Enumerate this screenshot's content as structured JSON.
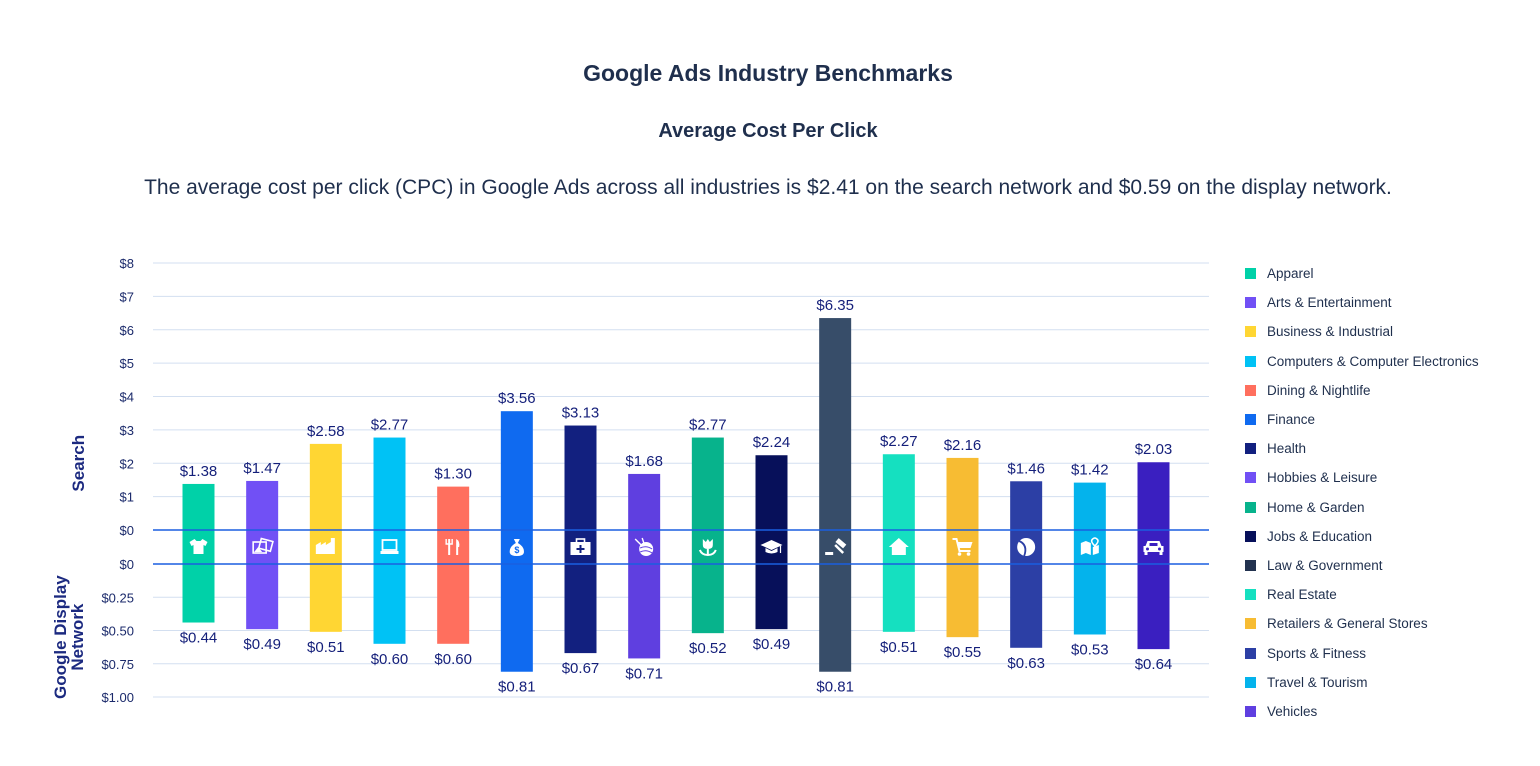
{
  "header": {
    "title": "Google Ads Industry Benchmarks",
    "subtitle": "Average Cost Per Click",
    "description": "The average cost per click (CPC) in Google Ads across all industries is $2.41 on the search network and $0.59 on the display network."
  },
  "chart_data": {
    "type": "bar",
    "title": "Google Ads Industry Benchmarks",
    "subtitle": "Average Cost Per Click",
    "ylabel_top": "Search",
    "ylabel_bottom": "Google Display Network",
    "search_axis": {
      "ylim": [
        0,
        8
      ],
      "ticks": [
        "$0",
        "$1",
        "$2",
        "$3",
        "$4",
        "$5",
        "$6",
        "$7",
        "$8"
      ],
      "tick_values": [
        0,
        1,
        2,
        3,
        4,
        5,
        6,
        7,
        8
      ]
    },
    "display_axis": {
      "ylim": [
        0,
        1
      ],
      "ticks": [
        "$0",
        "$0.25",
        "$0.50",
        "$0.75",
        "$1.00"
      ],
      "tick_values": [
        0,
        0.25,
        0.5,
        0.75,
        1
      ]
    },
    "grid": true,
    "legend_position": "right",
    "categories": [
      "Apparel",
      "Arts & Entertainment",
      "Business & Industrial",
      "Computers & Computer Electronics",
      "Dining & Nightlife",
      "Finance",
      "Health",
      "Hobbies & Leisure",
      "Home & Garden",
      "Jobs & Education",
      "Law & Government",
      "Real Estate",
      "Retailers & General Stores",
      "Sports & Fitness",
      "Travel & Tourism",
      "Vehicles"
    ],
    "colors": [
      "#00d1a8",
      "#7150f5",
      "#ffd633",
      "#00c2f5",
      "#ff6f5e",
      "#0f6af0",
      "#12207f",
      "#5f3fe0",
      "#07b38c",
      "#07105a",
      "#374d69",
      "#15e0c0",
      "#f7bc33",
      "#2c3fa5",
      "#04b3ec",
      "#3a1fc0"
    ],
    "icons": [
      "tshirt-icon",
      "pictures-icon",
      "factory-icon",
      "laptop-icon",
      "fork-knife-icon",
      "money-bag-icon",
      "first-aid-kit-icon",
      "yarn-ball-icon",
      "tulip-icon",
      "graduation-cap-icon",
      "gavel-icon",
      "house-icon",
      "shopping-cart-icon",
      "tennis-ball-icon",
      "map-pin-icon",
      "car-icon"
    ],
    "series": [
      {
        "name": "Search",
        "values": [
          1.38,
          1.47,
          2.58,
          2.77,
          1.3,
          3.56,
          3.13,
          1.68,
          2.77,
          2.24,
          6.35,
          2.27,
          2.16,
          1.46,
          1.42,
          2.03
        ],
        "labels": [
          "$1.38",
          "$1.47",
          "$2.58",
          "$2.77",
          "$1.30",
          "$3.56",
          "$3.13",
          "$1.68",
          "$2.77",
          "$2.24",
          "$6.35",
          "$2.27",
          "$2.16",
          "$1.46",
          "$1.42",
          "$2.03"
        ]
      },
      {
        "name": "Google Display Network",
        "values": [
          0.44,
          0.49,
          0.51,
          0.6,
          0.6,
          0.81,
          0.67,
          0.71,
          0.52,
          0.49,
          0.81,
          0.51,
          0.55,
          0.63,
          0.53,
          0.64
        ],
        "labels": [
          "$0.44",
          "$0.49",
          "$0.51",
          "$0.60",
          "$0.60",
          "$0.81",
          "$0.67",
          "$0.71",
          "$0.52",
          "$0.49",
          "$0.81",
          "$0.51",
          "$0.55",
          "$0.63",
          "$0.53",
          "$0.64"
        ]
      }
    ]
  },
  "legend": {
    "items": [
      {
        "label": "Apparel",
        "color": "#00d1a8"
      },
      {
        "label": "Arts & Entertainment",
        "color": "#7150f5"
      },
      {
        "label": "Business & Industrial",
        "color": "#ffd633"
      },
      {
        "label": "Computers & Computer Electronics",
        "color": "#00c2f5"
      },
      {
        "label": "Dining & Nightlife",
        "color": "#ff6f5e"
      },
      {
        "label": "Finance",
        "color": "#0f6af0"
      },
      {
        "label": "Health",
        "color": "#12207f"
      },
      {
        "label": "Hobbies & Leisure",
        "color": "#7150f5"
      },
      {
        "label": "Home & Garden",
        "color": "#07b38c"
      },
      {
        "label": "Jobs & Education",
        "color": "#07105a"
      },
      {
        "label": "Law & Government",
        "color": "#22324f"
      },
      {
        "label": "Real Estate",
        "color": "#15e0c0"
      },
      {
        "label": "Retailers & General Stores",
        "color": "#f7bc33"
      },
      {
        "label": "Sports & Fitness",
        "color": "#2c3fa5"
      },
      {
        "label": "Travel & Tourism",
        "color": "#04b3ec"
      },
      {
        "label": "Vehicles",
        "color": "#5f3fe0"
      }
    ]
  },
  "theme": {
    "axis_text": "#1b2a6b",
    "value_text": "#141f7a",
    "gridline": "#d3dff0",
    "zero_line": "#1a5fe0",
    "title_text": "#1f2f4d"
  }
}
